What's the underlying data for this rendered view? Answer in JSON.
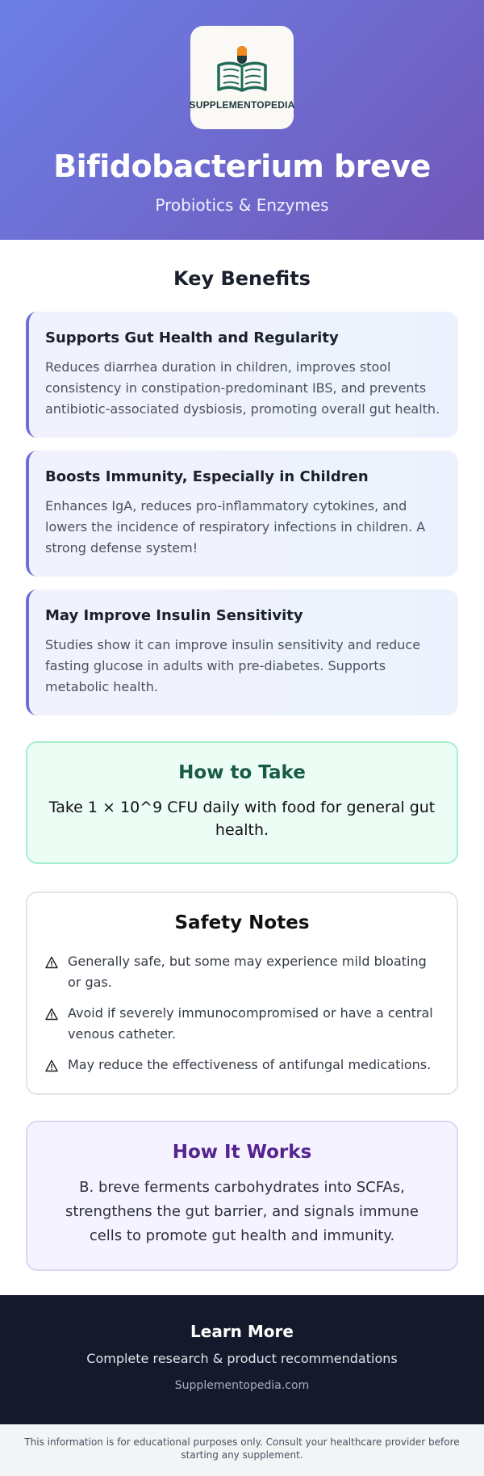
{
  "header": {
    "logo_text": "SUPPLEMENTOPEDIA",
    "title": "Bifidobacterium breve",
    "subtitle": "Probiotics & Enzymes"
  },
  "benefits": {
    "heading": "Key Benefits",
    "items": [
      {
        "title": "Supports Gut Health and Regularity",
        "text": "Reduces diarrhea duration in children, improves stool consistency in constipation-predominant IBS, and prevents antibiotic-associated dysbiosis, promoting overall gut health."
      },
      {
        "title": "Boosts Immunity, Especially in Children",
        "text": "Enhances IgA, reduces pro-inflammatory cytokines, and lowers the incidence of respiratory infections in children. A strong defense system!"
      },
      {
        "title": "May Improve Insulin Sensitivity",
        "text": "Studies show it can improve insulin sensitivity and reduce fasting glucose in adults with pre-diabetes. Supports metabolic health."
      }
    ]
  },
  "how_to_take": {
    "heading": "How to Take",
    "text": "Take 1 × 10^9 CFU daily with food for general gut health."
  },
  "safety": {
    "heading": "Safety Notes",
    "icon": "warning-icon",
    "items": [
      "Generally safe, but some may experience mild bloating or gas.",
      "Avoid if severely immunocompromised or have a central venous catheter.",
      "May reduce the effectiveness of antifungal medications."
    ]
  },
  "how_it_works": {
    "heading": "How It Works",
    "text": "B. breve ferments carbohydrates into SCFAs, strengthens the gut barrier, and signals immune cells to promote gut health and immunity."
  },
  "footer": {
    "title": "Learn More",
    "subtitle": "Complete research & product recommendations",
    "link": "Supplementopedia.com"
  },
  "disclaimer": "This information is for educational purposes only. Consult your healthcare provider before starting any supplement.",
  "colors": {
    "header_gradient_start": "#6b7fe6",
    "header_gradient_end": "#7257b8",
    "benefit_accent": "#6a6fd9",
    "howto_title": "#185b45",
    "works_title": "#55248f",
    "footer_bg": "#141a2b"
  }
}
